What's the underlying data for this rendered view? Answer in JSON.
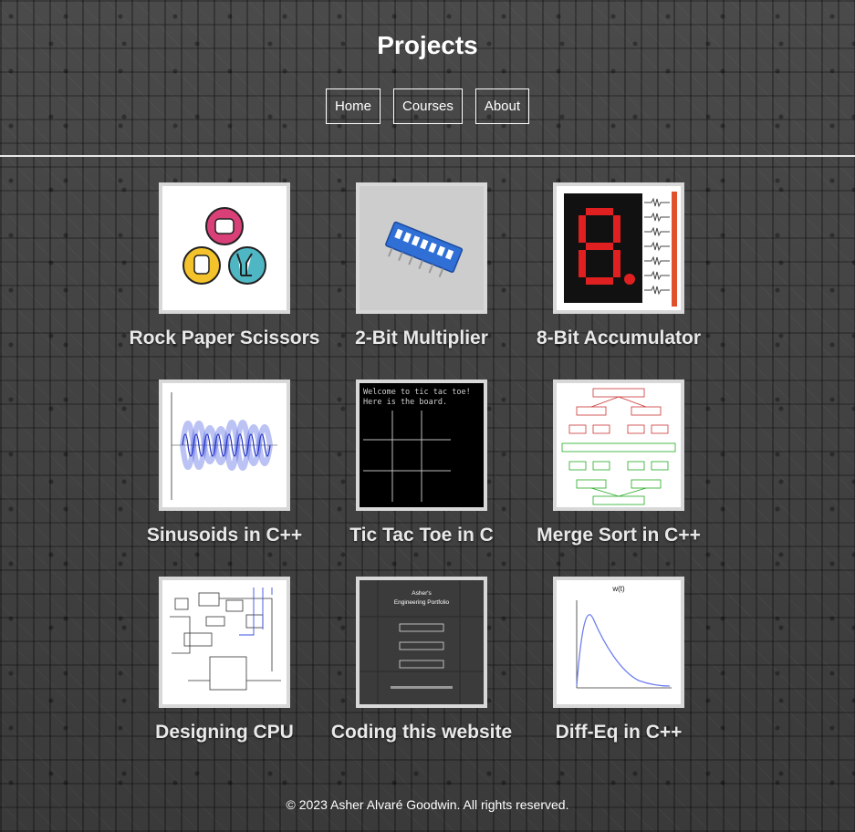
{
  "header": {
    "title": "Projects"
  },
  "nav": [
    {
      "label": "Home",
      "icon": "home-link"
    },
    {
      "label": "Courses",
      "icon": "courses-link"
    },
    {
      "label": "About",
      "icon": "about-link"
    }
  ],
  "projects": [
    {
      "label": "Rock Paper Scissors",
      "image": "rock-paper-scissors-icons"
    },
    {
      "label": "2-Bit Multiplier",
      "image": "blue-dip-switch-photo"
    },
    {
      "label": "8-Bit Accumulator",
      "image": "seven-segment-display-diagram"
    },
    {
      "label": "Sinusoids in C++",
      "image": "sinusoid-plot"
    },
    {
      "label": "Tic Tac Toe in C",
      "image": "terminal-tic-tac-toe-board",
      "terminal_lines": [
        "Welcome to tic tac toe!",
        "Here is the board."
      ]
    },
    {
      "label": "Merge Sort in C++",
      "image": "merge-sort-tree-diagram"
    },
    {
      "label": "Designing CPU",
      "image": "cpu-block-diagram"
    },
    {
      "label": "Coding this website",
      "image": "website-screenshot",
      "preview_title_lines": [
        "Asher's",
        "Engineering Portfolio"
      ]
    },
    {
      "label": "Diff-Eq in C++",
      "image": "decay-curve-plot",
      "plot_title": "w(t)"
    }
  ],
  "footer": {
    "text": "© 2023 Asher Alvaré Goodwin. All rights reserved."
  },
  "colors": {
    "background": "#3d3d3d",
    "text": "#ffffff",
    "card_border": "#d8d8d8",
    "plot_blue": "#3b4fe0",
    "display_red": "#e02020"
  }
}
